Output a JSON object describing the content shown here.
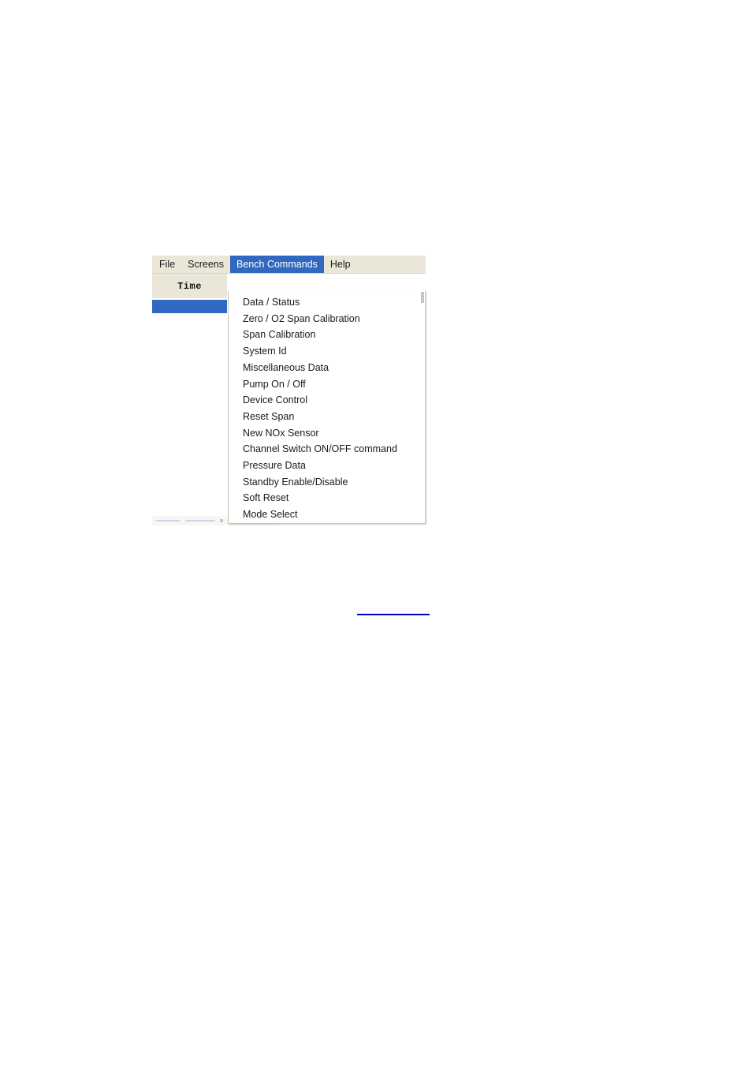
{
  "window": {
    "menubar": {
      "items": [
        {
          "label": "File",
          "active": false
        },
        {
          "label": "Screens",
          "active": false
        },
        {
          "label": "Bench Commands",
          "active": true
        },
        {
          "label": "Help",
          "active": false
        }
      ]
    },
    "grid": {
      "column_header": "Time",
      "selected_row_value": ""
    },
    "dropdown": {
      "owner": "Bench Commands",
      "items": [
        {
          "label": "Data / Status"
        },
        {
          "label": "Zero / O2 Span Calibration"
        },
        {
          "label": "Span Calibration"
        },
        {
          "label": "System Id"
        },
        {
          "label": "Miscellaneous Data"
        },
        {
          "label": "Pump On / Off"
        },
        {
          "label": "Device Control"
        },
        {
          "label": "Reset Span"
        },
        {
          "label": "New NOx Sensor"
        },
        {
          "label": "Channel Switch ON/OFF command"
        },
        {
          "label": "Pressure Data"
        },
        {
          "label": "Standby Enable/Disable"
        },
        {
          "label": "Soft Reset"
        },
        {
          "label": "Mode Select"
        }
      ]
    }
  },
  "colors": {
    "menubar_background": "#EAE7D8",
    "highlight_blue": "#3169C0",
    "menu_text": "#1A1A1A",
    "highlight_text": "#FFFFFF",
    "dropdown_background": "#FFFFFF",
    "dropdown_border": "#C8C4B2",
    "page_background": "#FFFFFF",
    "link_underline": "#0000C8"
  }
}
